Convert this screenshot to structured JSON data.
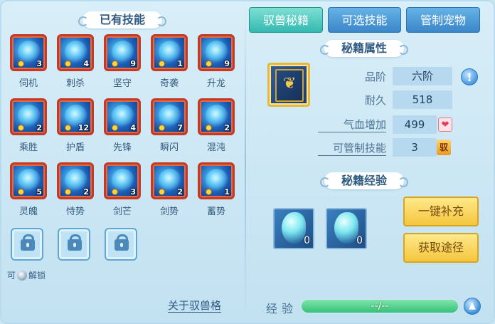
{
  "left": {
    "header": "已有技能",
    "skills": [
      {
        "name": "伺机",
        "count": "3"
      },
      {
        "name": "刺杀",
        "count": "4"
      },
      {
        "name": "坚守",
        "count": "9"
      },
      {
        "name": "奇袭",
        "count": "1"
      },
      {
        "name": "升龙",
        "count": "9"
      },
      {
        "name": "乘胜",
        "count": "2"
      },
      {
        "name": "护盾",
        "count": "12"
      },
      {
        "name": "先锋",
        "count": "4"
      },
      {
        "name": "瞬闪",
        "count": "7"
      },
      {
        "name": "混沌",
        "count": "2"
      },
      {
        "name": "灵魄",
        "count": "5"
      },
      {
        "name": "恃势",
        "count": "2"
      },
      {
        "name": "剑芒",
        "count": "3"
      },
      {
        "name": "剑势",
        "count": "2"
      },
      {
        "name": "蓄势",
        "count": "1"
      }
    ],
    "unlock_hint_prefix": "可",
    "unlock_hint_suffix": "解锁",
    "about_link": "关于驭兽格"
  },
  "tabs": {
    "book": "驭兽秘籍",
    "optional": "可选技能",
    "manage": "管制宠物"
  },
  "attributes": {
    "header": "秘籍属性",
    "grade_label": "品阶",
    "grade_value": "六阶",
    "durability_label": "耐久",
    "durability_value": "518",
    "hp_label": "气血增加",
    "hp_value": "499",
    "control_label": "可管制技能",
    "control_value": "3",
    "control_badge": "驭",
    "info_icon": "!"
  },
  "experience": {
    "header": "秘籍经验",
    "items": [
      {
        "count": "0"
      },
      {
        "count": "0"
      }
    ],
    "btn_refill": "一键补充",
    "btn_source": "获取途径",
    "label": "经验",
    "bar_text": "--/--"
  },
  "icons": {
    "info": "info-icon",
    "heart": "heart-icon",
    "up": "up-arrow-icon"
  },
  "colors": {
    "active_tab": "#33b8b0",
    "tab": "#3a86c8",
    "gold_button": "#f4c63e",
    "exp_bar": "#36c07a",
    "skill_border": "#c23a2a"
  }
}
